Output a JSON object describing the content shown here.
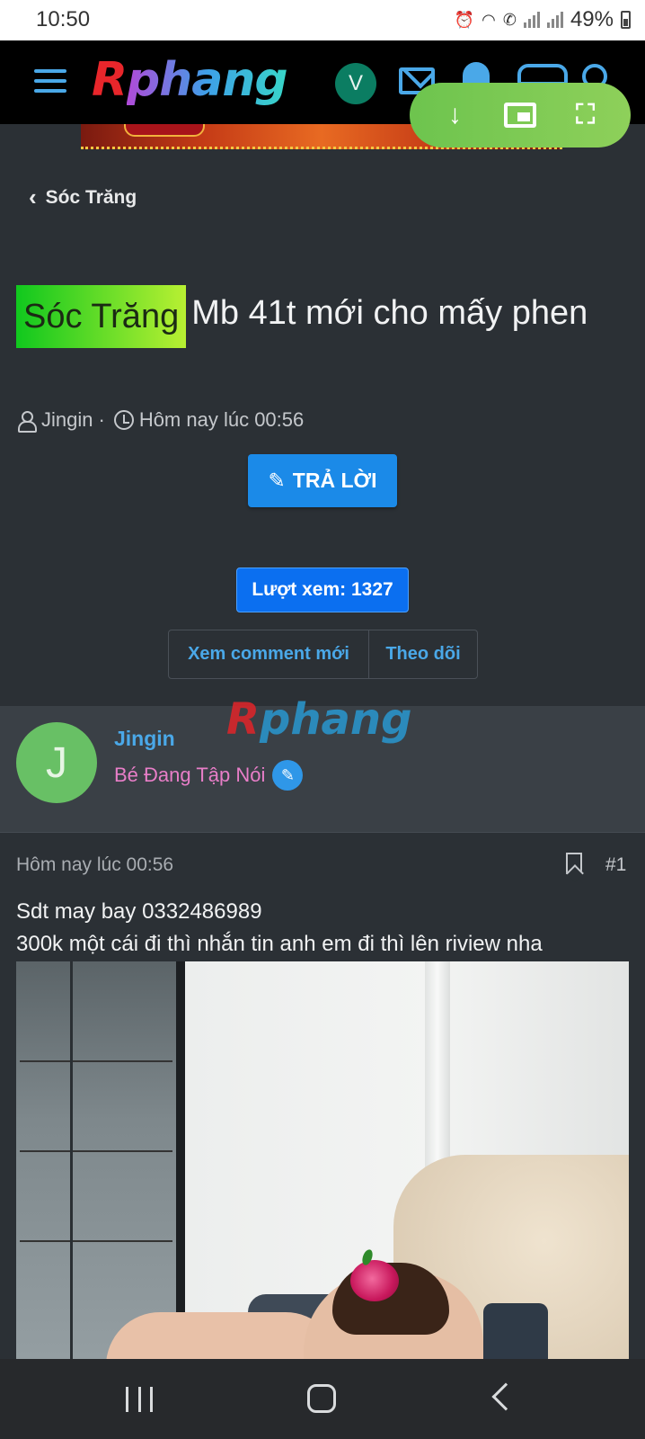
{
  "status_bar": {
    "time": "10:50",
    "battery": "49%"
  },
  "header": {
    "logo_part1": "R",
    "logo_part2": "phang",
    "avatar_letter": "V"
  },
  "breadcrumb": {
    "label": "Sóc Trăng"
  },
  "thread": {
    "prefix": "Sóc Trăng",
    "title": "Mb 41t mới cho mấy phen",
    "author": "Jingin",
    "separator": "·",
    "date": "Hôm nay lúc 00:56"
  },
  "actions": {
    "reply_label": "TRẢ LỜI",
    "views_label": "Lượt xem: 1327",
    "new_comments_label": "Xem comment mới",
    "follow_label": "Theo dõi"
  },
  "watermark": {
    "part1": "R",
    "part2": "phang"
  },
  "post": {
    "author_initial": "J",
    "author": "Jingin",
    "rank": "Bé Đang Tập Nói",
    "date": "Hôm nay lúc 00:56",
    "number": "#1",
    "line1": "Sdt may bay 0332486989",
    "line2": "300k một cái đi thì nhắn tin anh em đi thì lên riview nha"
  },
  "colors": {
    "accent": "#4aa8e8",
    "reply_button": "#1b8ae8",
    "views_badge": "#0b6ff0",
    "rank_color": "#e87ec8",
    "avatar_green": "#68c065",
    "floating_bar": "#7ccb54"
  },
  "icons": {
    "hamburger": "menu-icon",
    "mail": "mail-icon",
    "bell": "bell-icon",
    "shop": "shop-icon",
    "search": "search-icon",
    "download": "download-icon",
    "pip": "picture-in-picture-icon",
    "fullscreen": "fullscreen-icon",
    "bookmark": "bookmark-icon"
  }
}
